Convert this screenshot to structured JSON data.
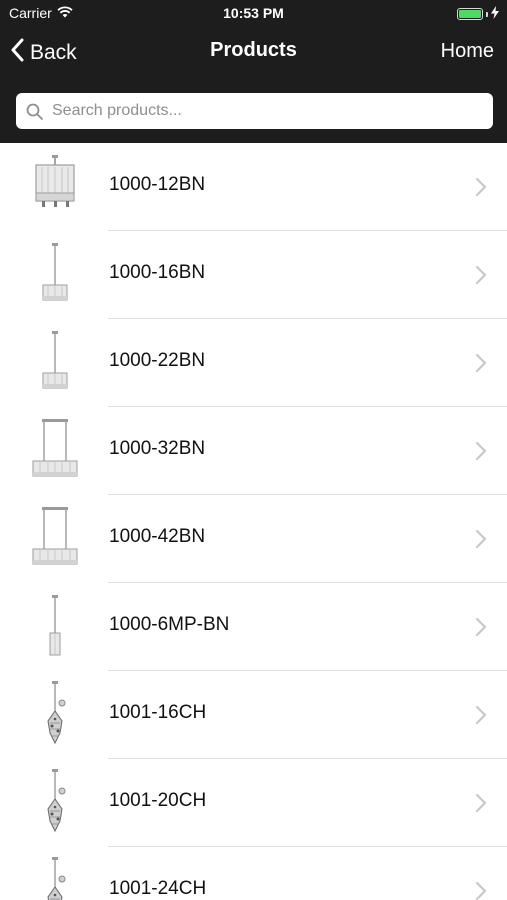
{
  "status_bar": {
    "carrier": "Carrier",
    "time": "10:53 PM",
    "wifi_icon": "wifi-icon",
    "battery_icon": "battery-charging-icon"
  },
  "nav": {
    "back_label": "Back",
    "title": "Products",
    "home_label": "Home"
  },
  "search": {
    "placeholder": "Search products...",
    "value": ""
  },
  "products": [
    {
      "code": "1000-12BN",
      "thumb": "square-chandelier"
    },
    {
      "code": "1000-16BN",
      "thumb": "small-pendant"
    },
    {
      "code": "1000-22BN",
      "thumb": "small-pendant"
    },
    {
      "code": "1000-32BN",
      "thumb": "linear-pendant"
    },
    {
      "code": "1000-42BN",
      "thumb": "linear-pendant"
    },
    {
      "code": "1000-6MP-BN",
      "thumb": "mini-pendant"
    },
    {
      "code": "1001-16CH",
      "thumb": "crystal-pendant"
    },
    {
      "code": "1001-20CH",
      "thumb": "crystal-pendant"
    },
    {
      "code": "1001-24CH",
      "thumb": "crystal-pendant"
    }
  ],
  "colors": {
    "nav_bg": "#1d1d1d",
    "battery_fill": "#4cd964",
    "separator": "#e1e1e4",
    "chevron": "#c7c7cc"
  }
}
